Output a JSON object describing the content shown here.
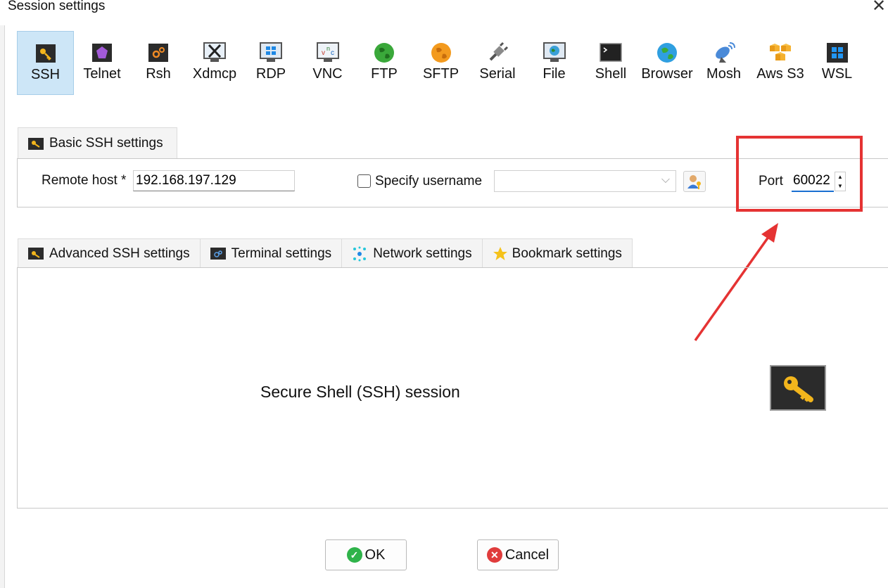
{
  "window": {
    "title": "Session settings",
    "close_glyph": "✕"
  },
  "session_types": [
    {
      "label": "SSH",
      "icon": "key-icon",
      "active": true
    },
    {
      "label": "Telnet",
      "icon": "telnet-gem-icon",
      "active": false
    },
    {
      "label": "Rsh",
      "icon": "rsh-gears-icon",
      "active": false
    },
    {
      "label": "Xdmcp",
      "icon": "xdmcp-x-icon",
      "active": false
    },
    {
      "label": "RDP",
      "icon": "rdp-windows-monitor-icon",
      "active": false
    },
    {
      "label": "VNC",
      "icon": "vnc-monitor-icon",
      "active": false
    },
    {
      "label": "FTP",
      "icon": "ftp-globe-icon",
      "active": false
    },
    {
      "label": "SFTP",
      "icon": "sftp-globe-icon",
      "active": false
    },
    {
      "label": "Serial",
      "icon": "serial-plug-icon",
      "active": false
    },
    {
      "label": "File",
      "icon": "file-monitor-icon",
      "active": false
    },
    {
      "label": "Shell",
      "icon": "shell-terminal-icon",
      "active": false
    },
    {
      "label": "Browser",
      "icon": "browser-globe-icon",
      "active": false
    },
    {
      "label": "Mosh",
      "icon": "mosh-satellite-icon",
      "active": false
    },
    {
      "label": "Aws S3",
      "icon": "aws-s3-cubes-icon",
      "active": false
    },
    {
      "label": "WSL",
      "icon": "wsl-windows-icon",
      "active": false
    }
  ],
  "basic": {
    "tab_label": "Basic SSH settings",
    "remote_host_label": "Remote host *",
    "remote_host_value": "192.168.197.129",
    "specify_username_label": "Specify username",
    "specify_username_checked": false,
    "username_value": "",
    "port_label": "Port",
    "port_value": "60022"
  },
  "advanced_tabs": [
    {
      "label": "Advanced SSH settings",
      "icon": "key-icon"
    },
    {
      "label": "Terminal settings",
      "icon": "terminal-gears-icon"
    },
    {
      "label": "Network settings",
      "icon": "network-nodes-icon"
    },
    {
      "label": "Bookmark settings",
      "icon": "star-icon"
    }
  ],
  "panel": {
    "description": "Secure Shell (SSH) session"
  },
  "buttons": {
    "ok": "OK",
    "cancel": "Cancel"
  },
  "colors": {
    "active_bg": "#cde6f7",
    "highlight_red": "#e53333",
    "ok_green": "#2fb34a",
    "cancel_red": "#e03c3c",
    "key_yellow": "#f2b51c"
  }
}
